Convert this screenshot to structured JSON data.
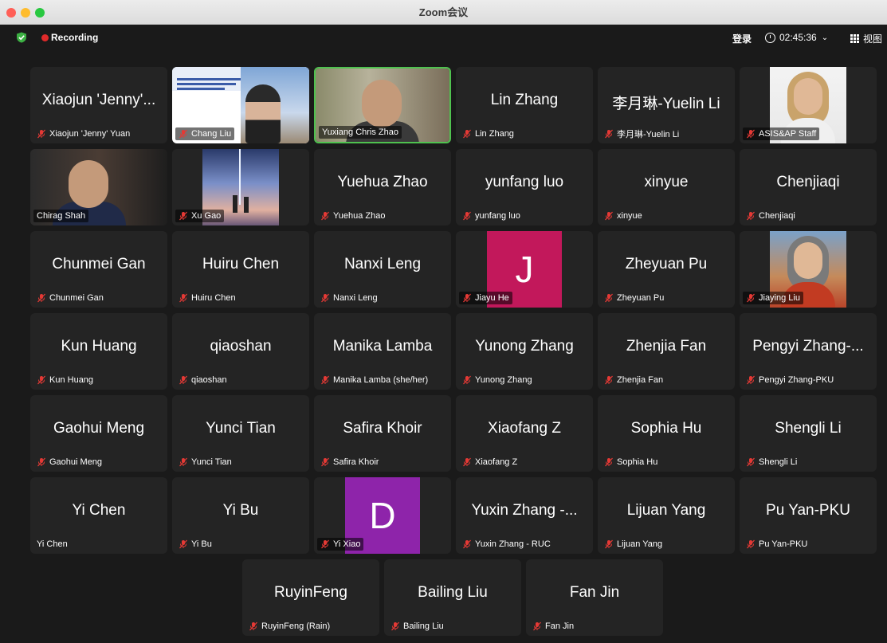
{
  "window": {
    "title": "Zoom会议"
  },
  "toolbar": {
    "recording_label": "Recording",
    "login_label": "登录",
    "timer": "02:45:36",
    "view_label": "视图"
  },
  "tiles": [
    {
      "big": "Xiaojun 'Jenny'...",
      "label": "Xiaojun 'Jenny' Yuan",
      "muted": true,
      "video": "none"
    },
    {
      "big": "",
      "label": "Chang Liu",
      "muted": true,
      "video": "slide"
    },
    {
      "big": "",
      "label": "Yuxiang Chris Zhao",
      "muted": false,
      "video": "camera",
      "active": true
    },
    {
      "big": "Lin Zhang",
      "label": "Lin Zhang",
      "muted": true,
      "video": "none"
    },
    {
      "big": "李月琳-Yuelin Li",
      "label": "李月琳-Yuelin Li",
      "muted": true,
      "video": "none"
    },
    {
      "big": "",
      "label": "ASIS&AP Staff",
      "muted": true,
      "video": "photo"
    },
    {
      "big": "",
      "label": "Chirag Shah",
      "muted": false,
      "video": "camera"
    },
    {
      "big": "",
      "label": "Xu Gao",
      "muted": true,
      "video": "photo"
    },
    {
      "big": "Yuehua Zhao",
      "label": "Yuehua Zhao",
      "muted": true,
      "video": "none"
    },
    {
      "big": "yunfang luo",
      "label": "yunfang luo",
      "muted": true,
      "video": "none"
    },
    {
      "big": "xinyue",
      "label": "xinyue",
      "muted": true,
      "video": "none"
    },
    {
      "big": "Chenjiaqi",
      "label": "Chenjiaqi",
      "muted": true,
      "video": "none"
    },
    {
      "big": "Chunmei Gan",
      "label": "Chunmei Gan",
      "muted": true,
      "video": "none"
    },
    {
      "big": "Huiru Chen",
      "label": "Huiru Chen",
      "muted": true,
      "video": "none"
    },
    {
      "big": "Nanxi Leng",
      "label": "Nanxi Leng",
      "muted": true,
      "video": "none"
    },
    {
      "big": "",
      "label": "Jiayu He",
      "muted": true,
      "video": "avatar",
      "letter": "J",
      "color": "#c2185b"
    },
    {
      "big": "Zheyuan Pu",
      "label": "Zheyuan Pu",
      "muted": true,
      "video": "none"
    },
    {
      "big": "",
      "label": "Jiaying Liu",
      "muted": true,
      "video": "photo"
    },
    {
      "big": "Kun Huang",
      "label": "Kun Huang",
      "muted": true,
      "video": "none"
    },
    {
      "big": "qiaoshan",
      "label": "qiaoshan",
      "muted": true,
      "video": "none"
    },
    {
      "big": "Manika Lamba",
      "label": "Manika Lamba (she/her)",
      "muted": true,
      "video": "none"
    },
    {
      "big": "Yunong Zhang",
      "label": "Yunong Zhang",
      "muted": true,
      "video": "none"
    },
    {
      "big": "Zhenjia Fan",
      "label": "Zhenjia Fan",
      "muted": true,
      "video": "none"
    },
    {
      "big": "Pengyi Zhang-...",
      "label": "Pengyi Zhang-PKU",
      "muted": true,
      "video": "none"
    },
    {
      "big": "Gaohui Meng",
      "label": "Gaohui Meng",
      "muted": true,
      "video": "none"
    },
    {
      "big": "Yunci Tian",
      "label": "Yunci Tian",
      "muted": true,
      "video": "none"
    },
    {
      "big": "Safira Khoir",
      "label": "Safira Khoir",
      "muted": true,
      "video": "none"
    },
    {
      "big": "Xiaofang Z",
      "label": "Xiaofang Z",
      "muted": true,
      "video": "none"
    },
    {
      "big": "Sophia Hu",
      "label": "Sophia Hu",
      "muted": true,
      "video": "none"
    },
    {
      "big": "Shengli Li",
      "label": "Shengli Li",
      "muted": true,
      "video": "none"
    },
    {
      "big": "Yi Chen",
      "label": "Yi Chen",
      "muted": false,
      "video": "none"
    },
    {
      "big": "Yi Bu",
      "label": "Yi Bu",
      "muted": true,
      "video": "none"
    },
    {
      "big": "",
      "label": "Yi Xiao",
      "muted": true,
      "video": "avatar",
      "letter": "D",
      "color": "#8e24aa"
    },
    {
      "big": "Yuxin Zhang -...",
      "label": "Yuxin Zhang - RUC",
      "muted": true,
      "video": "none"
    },
    {
      "big": "Lijuan Yang",
      "label": "Lijuan Yang",
      "muted": true,
      "video": "none"
    },
    {
      "big": "Pu Yan-PKU",
      "label": "Pu Yan-PKU",
      "muted": true,
      "video": "none"
    },
    {
      "big": "RuyinFeng",
      "label": "RuyinFeng (Rain)",
      "muted": true,
      "video": "none"
    },
    {
      "big": "Bailing Liu",
      "label": "Bailing Liu",
      "muted": true,
      "video": "none"
    },
    {
      "big": "Fan Jin",
      "label": "Fan Jin",
      "muted": true,
      "video": "none"
    }
  ]
}
